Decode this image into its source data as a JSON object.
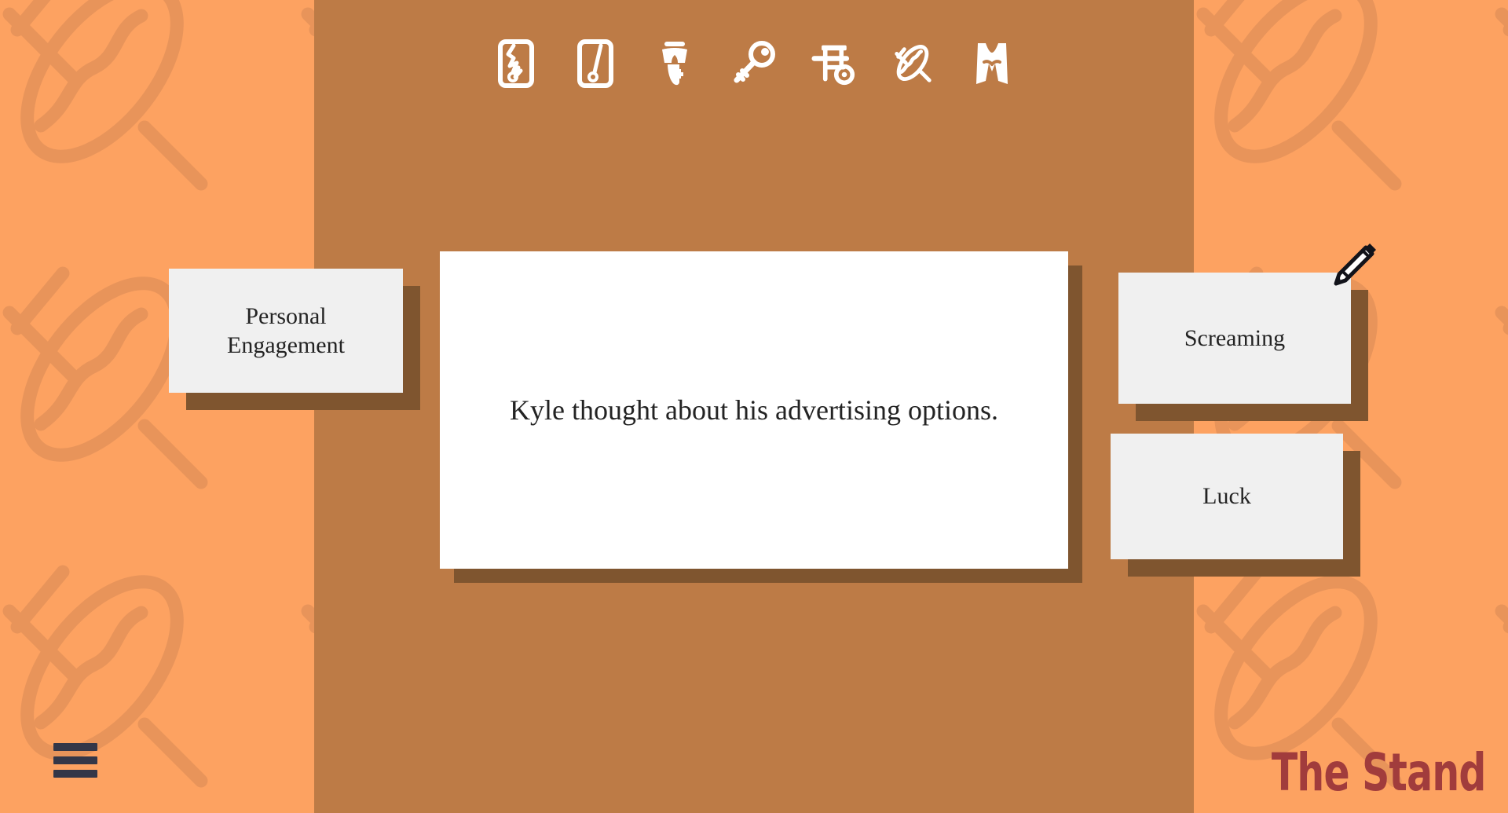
{
  "app": {
    "brand": "The Stand",
    "brand_color": "#A13C3C",
    "background_color": "#FDA261",
    "panel_color": "#BD7B46",
    "card_shadow_color": "#7F552F",
    "card_face_color": "#F0F0F0",
    "prompt_card_color": "#FFFFFF",
    "menu_color": "#343748"
  },
  "toolbar": {
    "icons": [
      {
        "name": "cracked-tablet-icon",
        "label": "Cracked Tablet"
      },
      {
        "name": "tablet-icon",
        "label": "Tablet"
      },
      {
        "name": "helmet-mask-icon",
        "label": "Helmet"
      },
      {
        "name": "key-icon",
        "label": "Key"
      },
      {
        "name": "cart-icon",
        "label": "Cart"
      },
      {
        "name": "rope-lasso-icon",
        "label": "Rope"
      },
      {
        "name": "vest-icon",
        "label": "Vest"
      }
    ]
  },
  "prompt": {
    "text": "Kyle thought about his advertising options."
  },
  "options": {
    "left": [
      {
        "label": "Personal\nEngagement"
      }
    ],
    "right": [
      {
        "label": "Screaming"
      },
      {
        "label": "Luck"
      }
    ]
  },
  "cursor": {
    "name": "pencil-cursor"
  },
  "menu": {
    "name": "hamburger-menu",
    "label": "Menu"
  }
}
